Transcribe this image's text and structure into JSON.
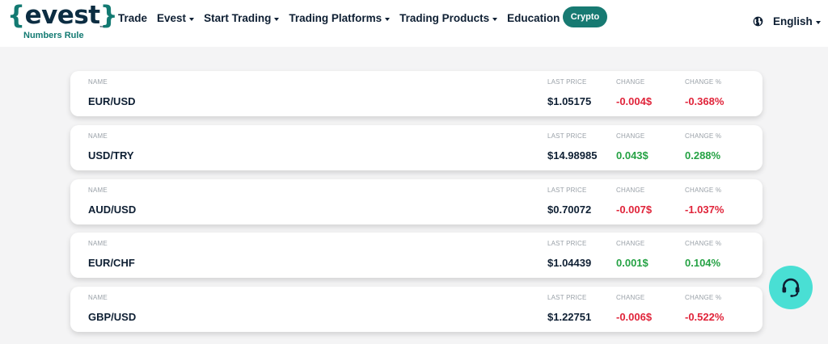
{
  "brand": {
    "logo_left_brace": "{",
    "logo_name": "evest",
    "logo_right_brace": "}",
    "tm": "™",
    "tagline": "Numbers Rule"
  },
  "nav": {
    "items": [
      {
        "label": "Trade"
      },
      {
        "label": "Evest"
      },
      {
        "label": "Start Trading"
      },
      {
        "label": "Trading Platforms"
      },
      {
        "label": "Trading Products"
      },
      {
        "label": "Education"
      }
    ],
    "crypto_label": "Crypto",
    "language": "English"
  },
  "table": {
    "headers": {
      "name": "NAME",
      "last_price": "LAST PRICE",
      "change": "CHANGE",
      "change_pct": "CHANGE %"
    },
    "rows": [
      {
        "name": "EUR/USD",
        "last_price": "$1.05175",
        "change": "-0.004$",
        "change_pct": "-0.368%",
        "direction": "down"
      },
      {
        "name": "USD/TRY",
        "last_price": "$14.98985",
        "change": "0.043$",
        "change_pct": "0.288%",
        "direction": "up"
      },
      {
        "name": "AUD/USD",
        "last_price": "$0.70072",
        "change": "-0.007$",
        "change_pct": "-1.037%",
        "direction": "down"
      },
      {
        "name": "EUR/CHF",
        "last_price": "$1.04439",
        "change": "0.001$",
        "change_pct": "0.104%",
        "direction": "up"
      },
      {
        "name": "GBP/USD",
        "last_price": "$1.22751",
        "change": "-0.006$",
        "change_pct": "-0.522%",
        "direction": "down"
      }
    ]
  },
  "colors": {
    "brand_teal": "#137a72",
    "negative": "#e0243a",
    "positive": "#25a244",
    "support_button": "#49dfd4"
  },
  "icons": {
    "language": "globe-icon",
    "support": "headset-icon"
  }
}
